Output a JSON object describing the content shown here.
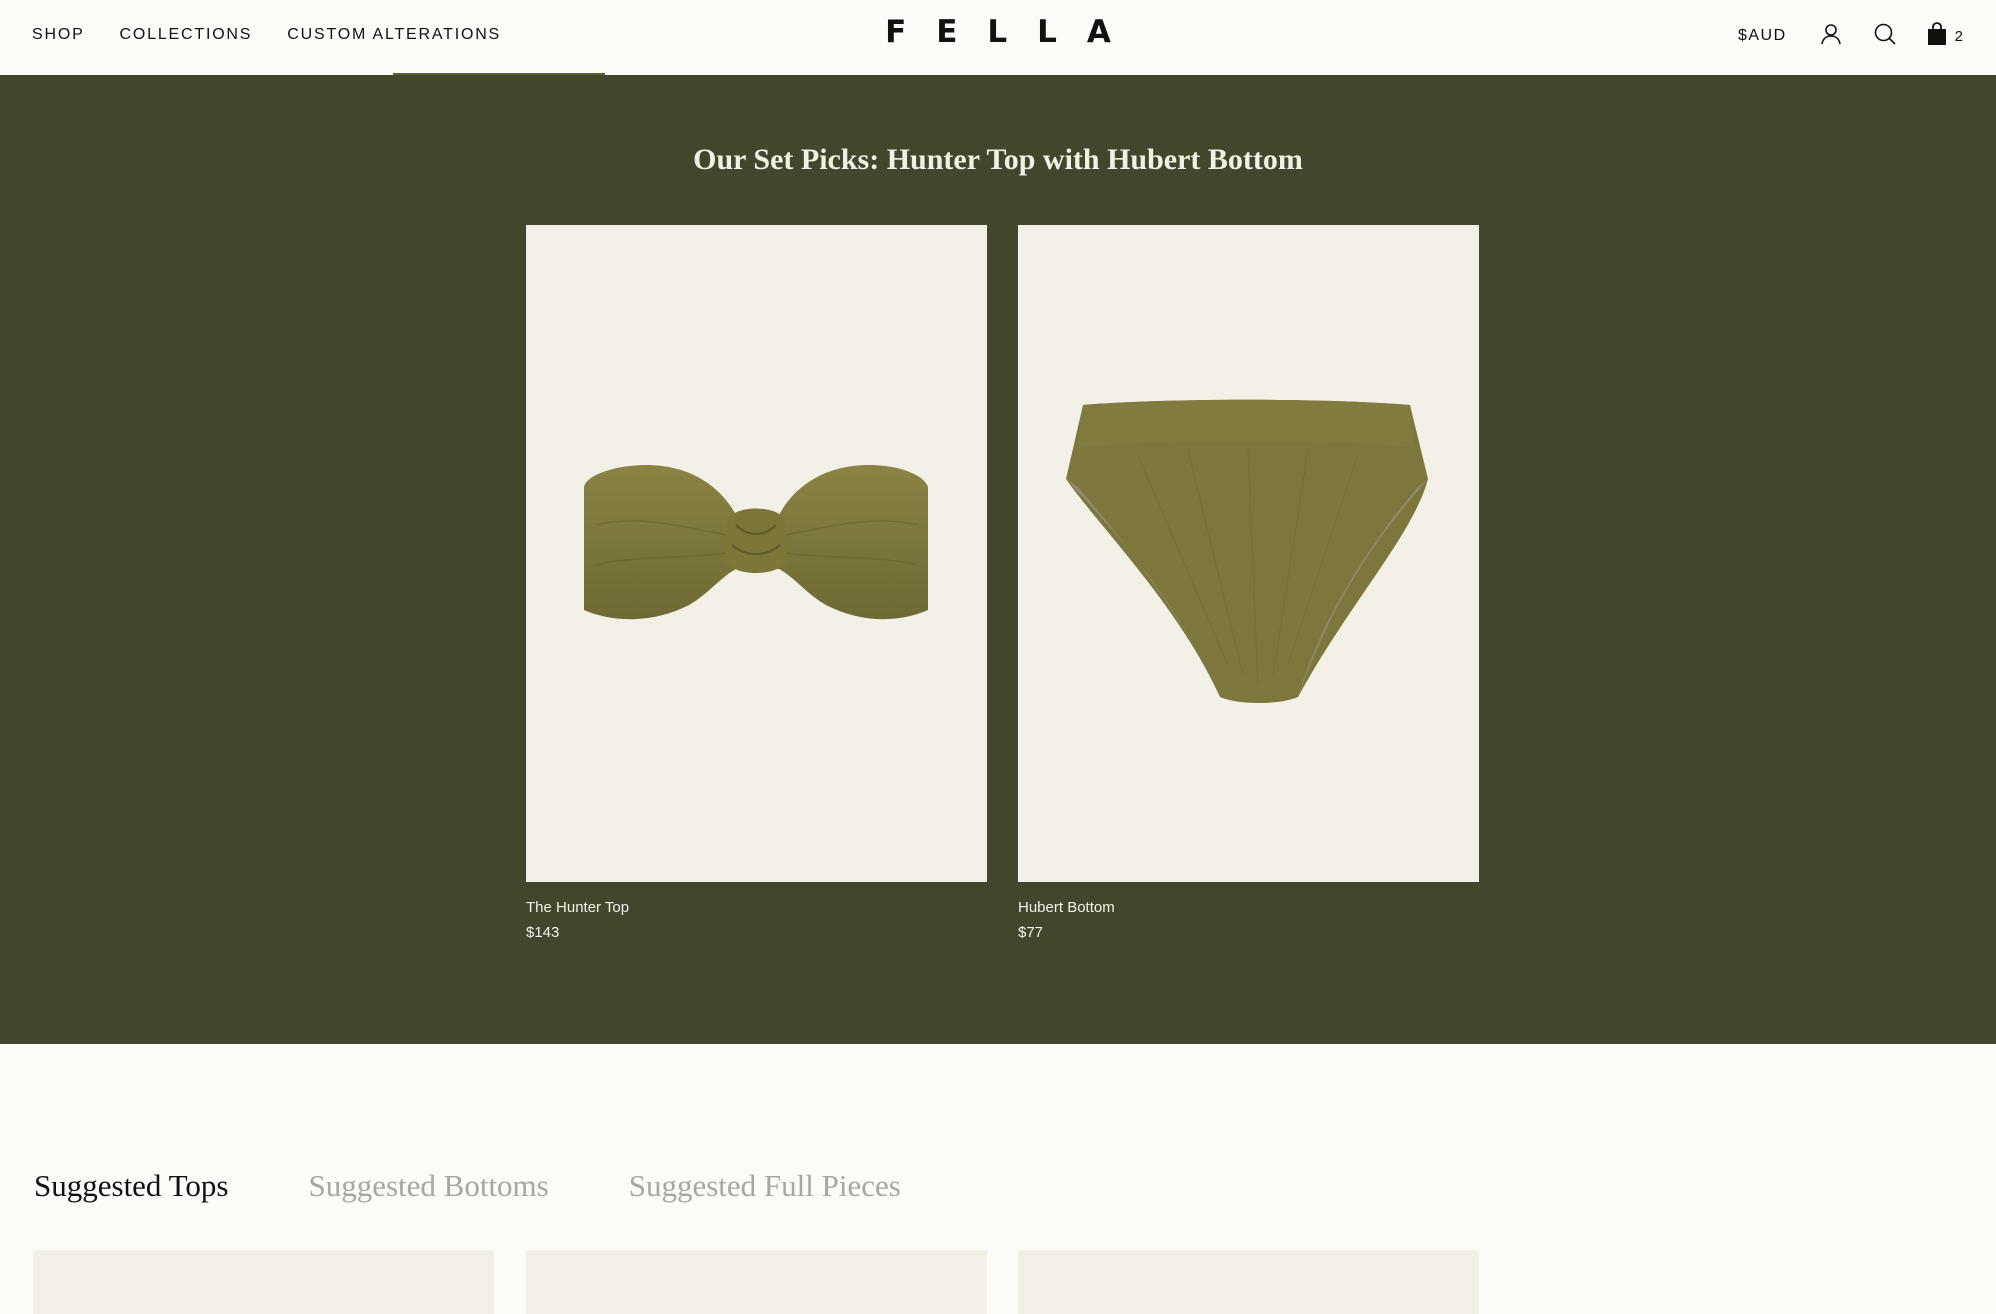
{
  "header": {
    "nav": [
      {
        "label": "SHOP"
      },
      {
        "label": "COLLECTIONS"
      },
      {
        "label": "CUSTOM ALTERATIONS"
      }
    ],
    "logo": "FELLA",
    "currency": "$AUD",
    "cart_count": "2",
    "icons": [
      "account-icon",
      "search-icon",
      "cart-bag-icon"
    ]
  },
  "set_section": {
    "title": "Our Set Picks: Hunter Top with Hubert Bottom",
    "background_color": "#43462c",
    "products": [
      {
        "name": "The Hunter Top",
        "price": "$143"
      },
      {
        "name": "Hubert Bottom",
        "price": "$77"
      }
    ]
  },
  "suggested": {
    "tabs": [
      {
        "label": "Suggested Tops",
        "active": true
      },
      {
        "label": "Suggested Bottoms",
        "active": false
      },
      {
        "label": "Suggested Full Pieces",
        "active": false
      }
    ]
  }
}
